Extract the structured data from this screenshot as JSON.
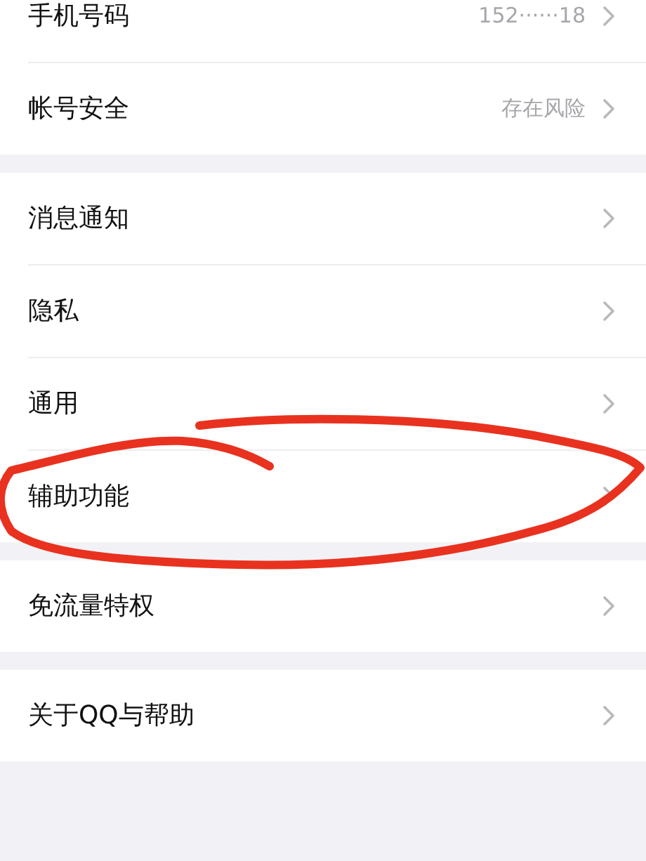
{
  "sections": [
    {
      "items": [
        {
          "label": "手机号码",
          "value": "152······18"
        },
        {
          "label": "帐号安全",
          "value": "存在风险"
        }
      ]
    },
    {
      "items": [
        {
          "label": "消息通知"
        },
        {
          "label": "隐私"
        },
        {
          "label": "通用"
        },
        {
          "label": "辅助功能"
        }
      ]
    },
    {
      "items": [
        {
          "label": "免流量特权"
        }
      ]
    },
    {
      "items": [
        {
          "label": "关于QQ与帮助"
        }
      ]
    }
  ]
}
